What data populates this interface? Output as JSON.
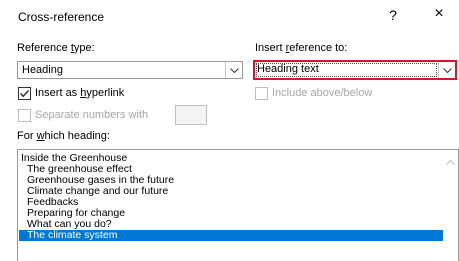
{
  "window": {
    "title": "Cross-reference",
    "help_label": "?",
    "close_label": "×"
  },
  "reference_type": {
    "label_prefix": "Reference ",
    "label_accel": "t",
    "label_suffix": "ype:",
    "value": "Heading"
  },
  "insert_reference_to": {
    "label_prefix": "Insert ",
    "label_accel": "r",
    "label_suffix": "eference to:",
    "value": "Heading text"
  },
  "insert_hyperlink": {
    "label_prefix": "Insert as ",
    "label_accel": "h",
    "label_suffix": "yperlink",
    "checked": true
  },
  "include_above_below": {
    "label": "Include above/below",
    "checked": false,
    "enabled": false
  },
  "separate_numbers": {
    "label": "Separate numbers with",
    "checked": false,
    "enabled": false,
    "value": ""
  },
  "heading_list": {
    "label_prefix": "For ",
    "label_accel": "w",
    "label_suffix": "hich heading:",
    "items": [
      {
        "text": "Inside the Greenhouse",
        "level": 1,
        "selected": false
      },
      {
        "text": "The greenhouse effect",
        "level": 2,
        "selected": false
      },
      {
        "text": "Greenhouse gases in the future",
        "level": 2,
        "selected": false
      },
      {
        "text": "Climate change and our future",
        "level": 2,
        "selected": false
      },
      {
        "text": "Feedbacks",
        "level": 2,
        "selected": false
      },
      {
        "text": "Preparing for change",
        "level": 2,
        "selected": false
      },
      {
        "text": "What can you do?",
        "level": 2,
        "selected": false
      },
      {
        "text": "The climate system",
        "level": 2,
        "selected": true
      }
    ]
  },
  "colors": {
    "selection": "#0078d7",
    "highlight_border": "#e0112c"
  }
}
